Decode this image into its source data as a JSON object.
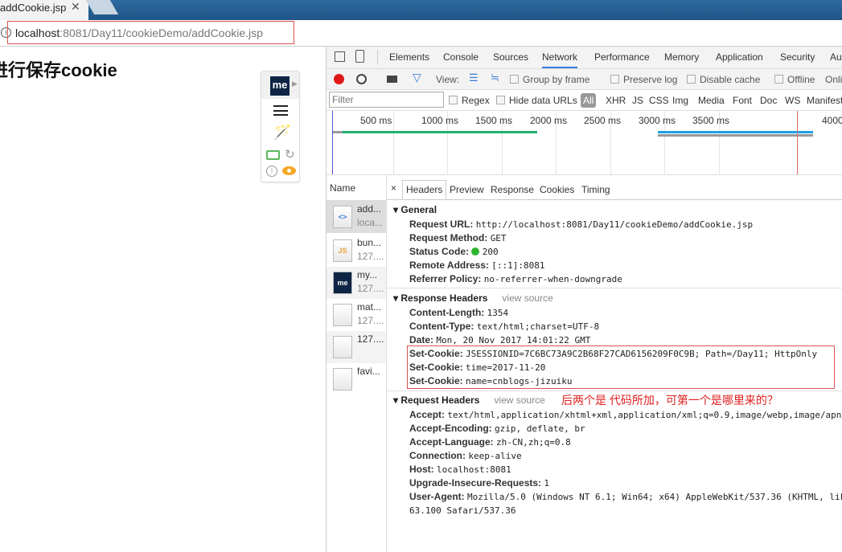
{
  "browser": {
    "tab_title": "addCookie.jsp",
    "url_host": "localhost",
    "url_path": ":8081/Day11/cookieDemo/addCookie.jsp"
  },
  "page": {
    "heading": "进行保存cookie"
  },
  "extension": {
    "logo": "me"
  },
  "devtools": {
    "tabs": [
      "Elements",
      "Console",
      "Sources",
      "Network",
      "Performance",
      "Memory",
      "Application",
      "Security",
      "Au"
    ],
    "active_tab": "Network",
    "toolbar": {
      "view_label": "View:",
      "group_by_frame": "Group by frame",
      "preserve_log": "Preserve log",
      "disable_cache": "Disable cache",
      "offline": "Offline",
      "online": "Onli"
    },
    "filter": {
      "placeholder": "Filter",
      "regex": "Regex",
      "hide_data_urls": "Hide data URLs",
      "types": [
        "All",
        "XHR",
        "JS",
        "CSS",
        "Img",
        "Media",
        "Font",
        "Doc",
        "WS",
        "Manifest"
      ]
    },
    "timeline": {
      "ticks": [
        "500 ms",
        "1000 ms",
        "1500 ms",
        "2000 ms",
        "2500 ms",
        "3000 ms",
        "3500 ms",
        "4000"
      ]
    },
    "name_header": "Name",
    "requests": [
      {
        "name": "add...",
        "host": "loca...",
        "icon": "html"
      },
      {
        "name": "bun...",
        "host": "127....",
        "icon": "JS"
      },
      {
        "name": "my...",
        "host": "127....",
        "icon": "me"
      },
      {
        "name": "mat...",
        "host": "127....",
        "icon": "file"
      },
      {
        "name": "127....",
        "host": "",
        "icon": "file"
      },
      {
        "name": "favi...",
        "host": "",
        "icon": "file"
      }
    ],
    "detail_tabs": [
      "Headers",
      "Preview",
      "Response",
      "Cookies",
      "Timing"
    ],
    "general": {
      "title": "General",
      "rows": [
        {
          "k": "Request URL:",
          "v": "http://localhost:8081/Day11/cookieDemo/addCookie.jsp"
        },
        {
          "k": "Request Method:",
          "v": "GET"
        },
        {
          "k": "Status Code:",
          "v": "200"
        },
        {
          "k": "Remote Address:",
          "v": "[::1]:8081"
        },
        {
          "k": "Referrer Policy:",
          "v": "no-referrer-when-downgrade"
        }
      ]
    },
    "response_headers": {
      "title": "Response Headers",
      "view_source": "view source",
      "rows": [
        {
          "k": "Content-Length:",
          "v": "1354"
        },
        {
          "k": "Content-Type:",
          "v": "text/html;charset=UTF-8"
        },
        {
          "k": "Date:",
          "v": "Mon, 20 Nov 2017 14:01:22 GMT"
        },
        {
          "k": "Set-Cookie:",
          "v": "JSESSIONID=7C6BC73A9C2B68F27CAD6156209F0C9B; Path=/Day11; HttpOnly"
        },
        {
          "k": "Set-Cookie:",
          "v": "time=2017-11-20"
        },
        {
          "k": "Set-Cookie:",
          "v": "name=cnblogs-jizuiku"
        }
      ]
    },
    "request_headers": {
      "title": "Request Headers",
      "view_source": "view source",
      "annotation": "后两个是 代码所加，可第一个是哪里来的？",
      "rows": [
        {
          "k": "Accept:",
          "v": "text/html,application/xhtml+xml,application/xml;q=0.9,image/webp,image/apng"
        },
        {
          "k": "Accept-Encoding:",
          "v": "gzip, deflate, br"
        },
        {
          "k": "Accept-Language:",
          "v": "zh-CN,zh;q=0.8"
        },
        {
          "k": "Connection:",
          "v": "keep-alive"
        },
        {
          "k": "Host:",
          "v": "localhost:8081"
        },
        {
          "k": "Upgrade-Insecure-Requests:",
          "v": "1"
        },
        {
          "k": "User-Agent:",
          "v": "Mozilla/5.0 (Windows NT 6.1; Win64; x64) AppleWebKit/537.36 (KHTML, lik"
        },
        {
          "k": "",
          "v": "63.100 Safari/537.36"
        }
      ]
    }
  },
  "colors": {
    "highlight_box": "#d9534f",
    "annotation": "#e02020",
    "status_ok": "#2fb52f",
    "record": "#e01818",
    "accent": "#3879d9"
  }
}
